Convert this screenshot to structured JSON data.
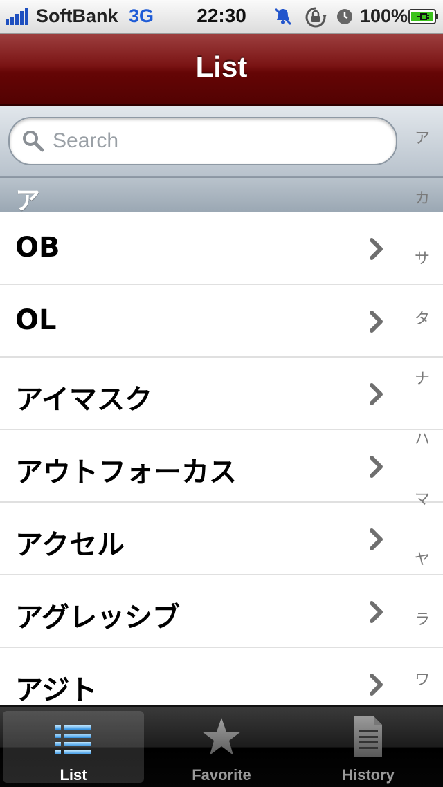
{
  "status_bar": {
    "carrier": "SoftBank",
    "network": "3G",
    "time": "22:30",
    "battery": "100%",
    "icons": [
      "signal-icon",
      "mute-bell-icon",
      "rotation-lock-icon",
      "alarm-clock-icon",
      "battery-charging-icon"
    ]
  },
  "nav": {
    "title": "List"
  },
  "search": {
    "placeholder": "Search",
    "value": ""
  },
  "section_header": "ア",
  "items": [
    {
      "label": "OB"
    },
    {
      "label": "OL"
    },
    {
      "label": "アイマスク"
    },
    {
      "label": "アウトフォーカス"
    },
    {
      "label": "アクセル"
    },
    {
      "label": "アグレッシブ"
    },
    {
      "label": "アジト"
    }
  ],
  "index": [
    "ア",
    "カ",
    "サ",
    "タ",
    "ナ",
    "ハ",
    "マ",
    "ヤ",
    "ラ",
    "ワ"
  ],
  "tabs": [
    {
      "label": "List",
      "icon": "list-icon",
      "active": true
    },
    {
      "label": "Favorite",
      "icon": "star-icon",
      "active": false
    },
    {
      "label": "History",
      "icon": "document-icon",
      "active": false
    }
  ],
  "colors": {
    "nav_bar": "#6a0808",
    "index_text": "#7a7a7a",
    "chevron": "#6f6f6f",
    "tab_active": "#ffffff"
  }
}
